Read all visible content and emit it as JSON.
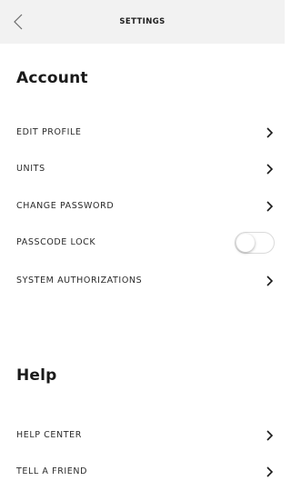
{
  "nav": {
    "back_icon": "chevron-left-icon",
    "title": "SETTINGS"
  },
  "account": {
    "title": "Account",
    "items": [
      {
        "label": "EDIT PROFILE",
        "control": "chevron"
      },
      {
        "label": "UNITS",
        "control": "chevron"
      },
      {
        "label": "CHANGE PASSWORD",
        "control": "chevron"
      },
      {
        "label": "PASSCODE LOCK",
        "control": "toggle",
        "enabled": false
      },
      {
        "label": "SYSTEM AUTHORIZATIONS",
        "control": "chevron"
      }
    ]
  },
  "help": {
    "title": "Help",
    "items": [
      {
        "label": "HELP CENTER",
        "control": "chevron"
      },
      {
        "label": "TELL A FRIEND",
        "control": "chevron"
      }
    ]
  },
  "colors": {
    "navbar_bg": "#f2f2f2",
    "text": "#1a1a1a",
    "toggle_off": "#ffffff"
  }
}
